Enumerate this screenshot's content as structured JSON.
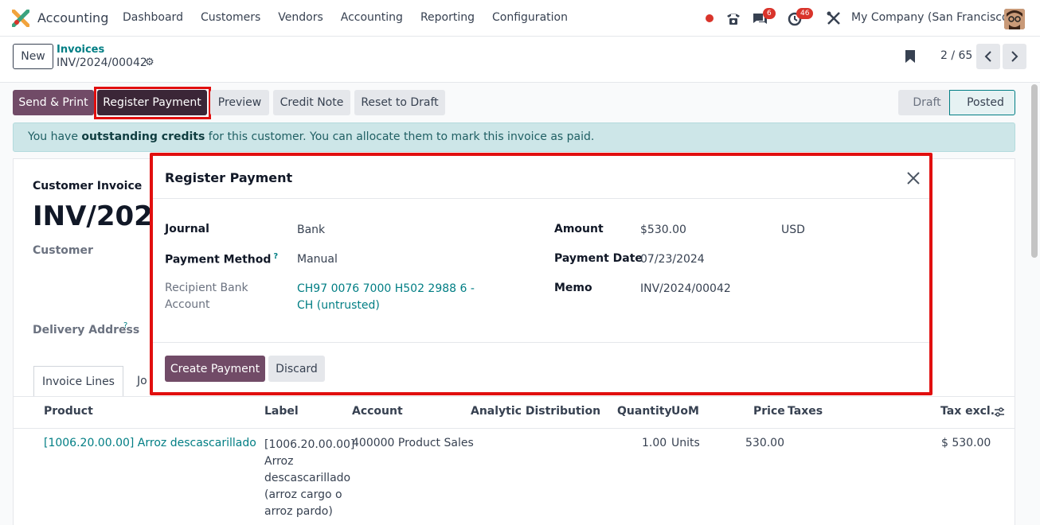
{
  "navbar": {
    "app_name": "Accounting",
    "menu": [
      "Dashboard",
      "Customers",
      "Vendors",
      "Accounting",
      "Reporting",
      "Configuration"
    ],
    "messages_badge": "6",
    "activities_badge": "46",
    "company": "My Company (San Francisco)"
  },
  "control": {
    "new_label": "New",
    "breadcrumb_parent": "Invoices",
    "breadcrumb_current": "INV/2024/00042",
    "pager": "2 / 65"
  },
  "actions": {
    "send_print": "Send & Print",
    "register_payment": "Register Payment",
    "preview": "Preview",
    "credit_note": "Credit Note",
    "reset_draft": "Reset to Draft"
  },
  "status": {
    "draft": "Draft",
    "posted": "Posted"
  },
  "alert": {
    "pre": "You have ",
    "bold": "outstanding credits",
    "post": " for this customer. You can allocate them to mark this invoice as paid."
  },
  "sheet": {
    "type_label": "Customer Invoice",
    "number_partial": "INV/2024",
    "customer_label": "Customer",
    "delivery_label": "Delivery Address",
    "tab_invoice_lines": "Invoice Lines",
    "tab_journal_partial": "Jo",
    "columns": [
      "Product",
      "Label",
      "Account",
      "Analytic Distribution",
      "Quantity",
      "UoM",
      "Price",
      "Taxes",
      "Tax excl."
    ],
    "line": {
      "product": "[1006.20.00.00] Arroz descascarillado (arroz",
      "label_lines": [
        "[1006.20.00.00]",
        "Arroz",
        "descascarillado",
        "(arroz cargo o",
        "arroz pardo)"
      ],
      "account": "400000 Product Sales",
      "quantity": "1.00",
      "uom": "Units",
      "price": "530.00",
      "tax_excl": "$ 530.00"
    }
  },
  "modal": {
    "title": "Register Payment",
    "journal_label": "Journal",
    "journal_value": "Bank",
    "method_label": "Payment Method",
    "method_help": "?",
    "method_value": "Manual",
    "recipient_label": "Recipient Bank Account",
    "recipient_value": "CH97 0076 7000 H502 2988 6 - CH (untrusted)",
    "amount_label": "Amount",
    "amount_value": "$530.00",
    "currency": "USD",
    "date_label": "Payment Date",
    "date_value": "07/23/2024",
    "memo_label": "Memo",
    "memo_value": "INV/2024/00042",
    "create_label": "Create Payment",
    "discard_label": "Discard"
  },
  "colors": {
    "primary": "#714b67",
    "link": "#017e84",
    "highlight": "#e10f0f",
    "alert_bg": "#cde6e8"
  }
}
